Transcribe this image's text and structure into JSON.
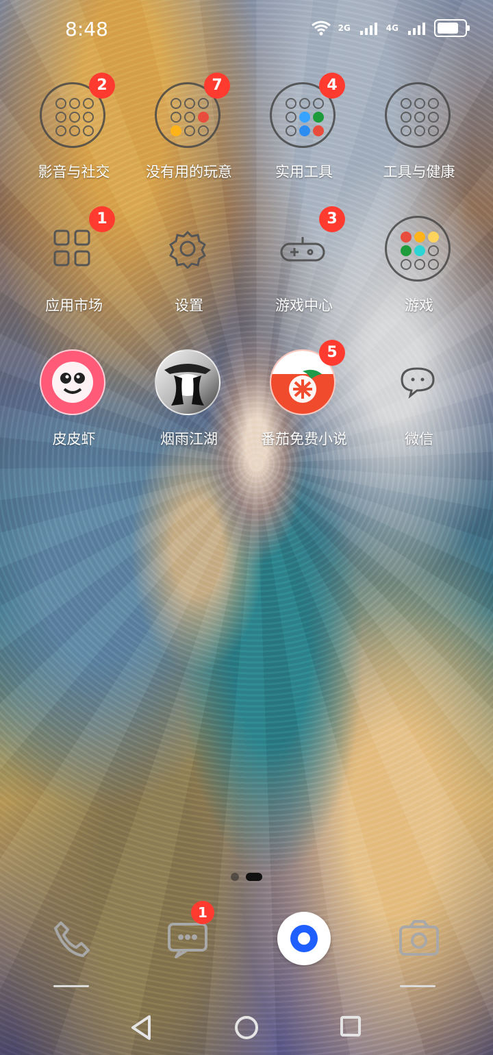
{
  "status_bar": {
    "time": "8:48",
    "network_2g": "2G",
    "network_4g": "4G"
  },
  "home": {
    "rows": [
      [
        {
          "label": "影音与社交",
          "badge": "2"
        },
        {
          "label": "没有用的玩意",
          "badge": "7"
        },
        {
          "label": "实用工具",
          "badge": "4"
        },
        {
          "label": "工具与健康",
          "badge": ""
        }
      ],
      [
        {
          "label": "应用市场",
          "badge": "1"
        },
        {
          "label": "设置",
          "badge": ""
        },
        {
          "label": "游戏中心",
          "badge": "3"
        },
        {
          "label": "游戏",
          "badge": ""
        }
      ],
      [
        {
          "label": "皮皮虾",
          "badge": ""
        },
        {
          "label": "烟雨江湖",
          "badge": ""
        },
        {
          "label": "番茄免费小说",
          "badge": "5"
        },
        {
          "label": "微信",
          "badge": ""
        }
      ]
    ]
  },
  "dock": {
    "messages_badge": "1"
  },
  "icons": {
    "phone": "phone-icon",
    "messages": "messages-icon",
    "browser": "browser-icon",
    "camera": "camera-icon",
    "back": "back-icon",
    "home": "home-icon",
    "recent": "recent-apps-icon",
    "wifi": "wifi-icon",
    "battery": "battery-icon",
    "signal": "signal-icon"
  },
  "colors": {
    "badge": "#ff3b30",
    "dock_accent": "#1f5eff"
  }
}
